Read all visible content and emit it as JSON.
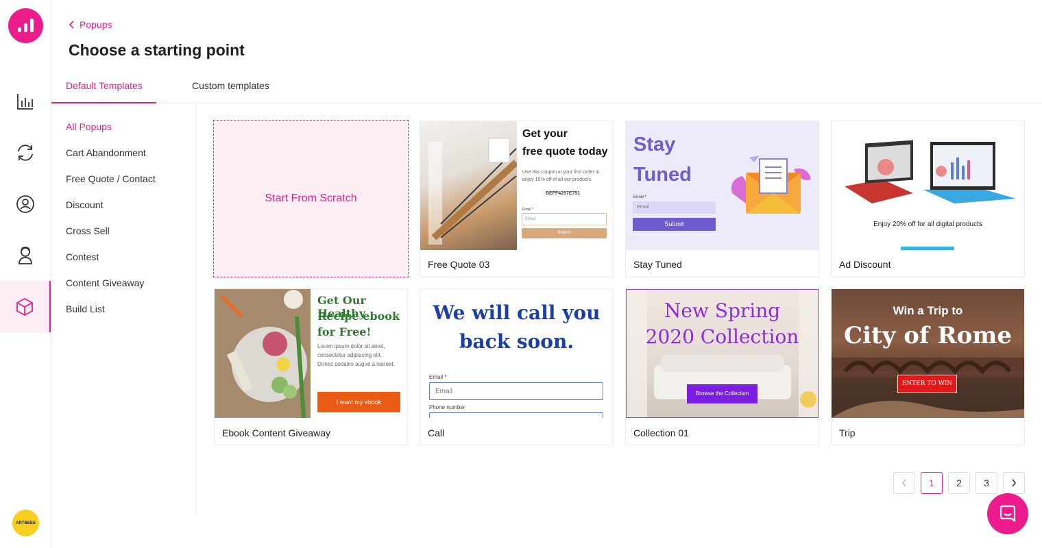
{
  "colors": {
    "accent": "#ec1c8d",
    "accent_light": "#fdeef4"
  },
  "sidebar": {
    "items": [
      {
        "icon": "analytics-icon"
      },
      {
        "icon": "sync-icon"
      },
      {
        "icon": "user-circle-icon"
      },
      {
        "icon": "support-agent-icon"
      },
      {
        "icon": "cube-icon",
        "active": true
      }
    ],
    "avatar_text": "ARTBEES"
  },
  "header": {
    "back_label": "Popups",
    "title": "Choose a starting point"
  },
  "tabs": [
    {
      "label": "Default Templates",
      "active": true
    },
    {
      "label": "Custom templates"
    }
  ],
  "categories": [
    {
      "label": "All Popups",
      "active": true
    },
    {
      "label": "Cart Abandonment"
    },
    {
      "label": "Free Quote / Contact"
    },
    {
      "label": "Discount"
    },
    {
      "label": "Cross Sell"
    },
    {
      "label": "Contest"
    },
    {
      "label": "Content Giveaway"
    },
    {
      "label": "Build List"
    }
  ],
  "scratch_label": "Start From Scratch",
  "templates": [
    {
      "name": "Free Quote 03",
      "title1": "Get your",
      "title2": "free quote today",
      "text1": "Use this coupon in your first order to",
      "text2": "enjoy 15% off of all our products.",
      "code": "BEFF4297E751",
      "field_label": "Email *",
      "field_placeholder": "Email",
      "button": "Submit"
    },
    {
      "name": "Stay Tuned",
      "title1": "Stay",
      "title2": "Tuned",
      "field_label": "Email *",
      "field_placeholder": "Email",
      "button": "Submit"
    },
    {
      "name": "Ad Discount",
      "text": "Enjoy 20% off for all digital products"
    },
    {
      "name": "Ebook Content Giveaway",
      "title1": "Get Our Healthy",
      "title2": "Recipe ebook",
      "title3": "for Free!",
      "text1": "Lorem ipsum dolor sit amet,",
      "text2": "consectetur adipiscing elit.",
      "text3": "Donec sodales augue a laoreet.",
      "button": "I want my ebook"
    },
    {
      "name": "Call",
      "title1": "We will call you",
      "title2": "back soon.",
      "field1_label": "Email *",
      "field1_placeholder": "Email",
      "field2_label": "Phone number"
    },
    {
      "name": "Collection 01",
      "title1": "New Spring",
      "title2": "2020 Collection",
      "button": "Browse the Collection"
    },
    {
      "name": "Trip",
      "title1": "Win a Trip to",
      "title2": "City of Rome",
      "button": "ENTER TO WIN"
    }
  ],
  "pagination": {
    "prev": "‹",
    "pages": [
      "1",
      "2",
      "3"
    ],
    "current": "1",
    "next": "›"
  },
  "chat_icon": "chat-icon"
}
